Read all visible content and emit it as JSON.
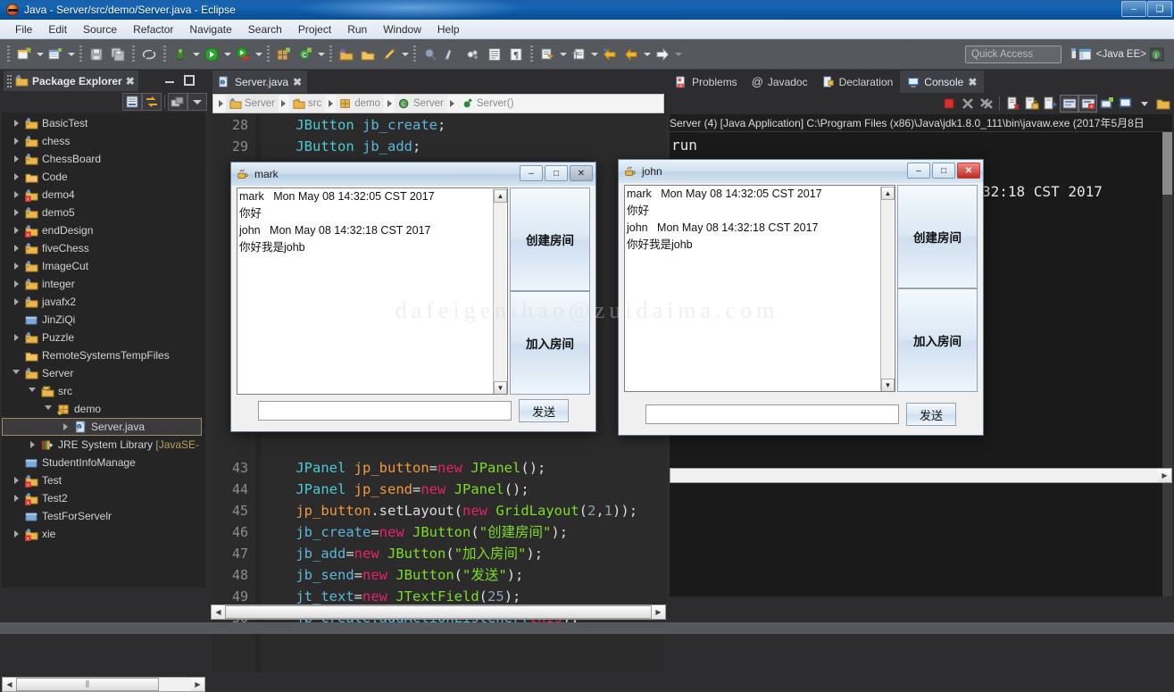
{
  "window": {
    "title": "Java - Server/src/demo/Server.java - Eclipse",
    "logo_icon": "eclipse-logo-icon",
    "minimize": "–",
    "maximize": "❑",
    "close": "✕"
  },
  "menubar": {
    "items": [
      "File",
      "Edit",
      "Source",
      "Refactor",
      "Navigate",
      "Search",
      "Project",
      "Run",
      "Window",
      "Help"
    ]
  },
  "toolbar": {
    "groups": [
      {
        "buttons": [
          {
            "icon": "new-file-icon",
            "dropdown": true
          },
          {
            "icon": "new-wizard-icon",
            "dropdown": true
          }
        ]
      },
      {
        "buttons": [
          {
            "icon": "save-icon",
            "dropdown": false
          },
          {
            "icon": "save-all-icon",
            "dropdown": false
          }
        ]
      },
      {
        "buttons": [
          {
            "icon": "no-link-icon",
            "dropdown": false
          }
        ]
      },
      {
        "buttons": [
          {
            "icon": "debug-bug-icon",
            "dropdown": true
          },
          {
            "icon": "run-green-icon",
            "dropdown": true
          },
          {
            "icon": "run-external-tools-icon",
            "dropdown": true
          }
        ]
      },
      {
        "buttons": [
          {
            "icon": "new-java-project-icon",
            "dropdown": false
          },
          {
            "icon": "new-class-icon",
            "dropdown": true
          }
        ]
      },
      {
        "buttons": [
          {
            "icon": "open-type-icon",
            "dropdown": false
          },
          {
            "icon": "open-resource-icon",
            "dropdown": false
          },
          {
            "icon": "marker-pen-icon",
            "dropdown": true
          }
        ]
      },
      {
        "buttons": [
          {
            "icon": "search-globe-icon",
            "dropdown": false
          },
          {
            "icon": "ruler-icon",
            "dropdown": false
          },
          {
            "icon": "toggle-mark-occurrences-icon",
            "dropdown": false
          },
          {
            "icon": "show-whitespace-icon",
            "dropdown": false
          },
          {
            "icon": "pilcrow-icon",
            "dropdown": false
          }
        ]
      },
      {
        "buttons": [
          {
            "icon": "next-annotation-icon",
            "dropdown": true
          },
          {
            "icon": "previous-annotation-icon",
            "dropdown": true
          }
        ]
      },
      {
        "buttons": [
          {
            "icon": "back-history-icon",
            "dropdown": false
          },
          {
            "icon": "forward-back-icon",
            "dropdown": true
          },
          {
            "icon": "forward-history-icon",
            "dropdown": true
          }
        ]
      }
    ],
    "quick_access_placeholder": "Quick Access",
    "new_perspective_icon": "new-perspective-icon",
    "perspective_icon": "java-ee-perspective-icon",
    "perspective_label": "<Java EE>"
  },
  "package_explorer": {
    "tab_title": "Package Explorer",
    "close_icon": "close-icon",
    "minimize_icon": "minimize-icon",
    "maximize_icon": "maximize-icon",
    "view_buttons": [
      {
        "icon": "collapse-all-icon",
        "framed": true
      },
      {
        "icon": "link-with-editor-icon",
        "framed": true
      },
      {
        "icon": "focus-on-active-task-icon",
        "framed": true
      },
      {
        "icon": "view-menu-icon",
        "framed": true
      }
    ],
    "tree": [
      {
        "label": "BasicTest",
        "indent": 0,
        "arrow": "closed",
        "icon": "java-project-icon",
        "selected": false
      },
      {
        "label": "chess",
        "indent": 0,
        "arrow": "closed",
        "icon": "java-project-icon",
        "selected": false
      },
      {
        "label": "ChessBoard",
        "indent": 0,
        "arrow": "closed",
        "icon": "java-project-icon",
        "selected": false
      },
      {
        "label": "Code",
        "indent": 0,
        "arrow": "closed",
        "icon": "project-folder-icon",
        "selected": false
      },
      {
        "label": "demo4",
        "indent": 0,
        "arrow": "closed",
        "icon": "java-project-error-icon",
        "selected": false
      },
      {
        "label": "demo5",
        "indent": 0,
        "arrow": "closed",
        "icon": "java-project-icon",
        "selected": false
      },
      {
        "label": "endDesign",
        "indent": 0,
        "arrow": "closed",
        "icon": "java-project-error-icon",
        "selected": false
      },
      {
        "label": "fiveChess",
        "indent": 0,
        "arrow": "closed",
        "icon": "java-project-icon",
        "selected": false
      },
      {
        "label": "ImageCut",
        "indent": 0,
        "arrow": "closed",
        "icon": "java-project-icon",
        "selected": false
      },
      {
        "label": "integer",
        "indent": 0,
        "arrow": "closed",
        "icon": "java-project-icon",
        "selected": false
      },
      {
        "label": "javafx2",
        "indent": 0,
        "arrow": "closed",
        "icon": "java-project-icon",
        "selected": false
      },
      {
        "label": "JinZiQi",
        "indent": 0,
        "arrow": "none",
        "icon": "closed-project-icon",
        "selected": false
      },
      {
        "label": "Puzzle",
        "indent": 0,
        "arrow": "closed",
        "icon": "java-project-icon",
        "selected": false
      },
      {
        "label": "RemoteSystemsTempFiles",
        "indent": 0,
        "arrow": "none",
        "icon": "project-folder-icon",
        "selected": false
      },
      {
        "label": "Server",
        "indent": 0,
        "arrow": "open",
        "icon": "java-project-icon",
        "selected": false
      },
      {
        "label": "src",
        "indent": 1,
        "arrow": "open",
        "icon": "source-folder-icon",
        "selected": false
      },
      {
        "label": "demo",
        "indent": 2,
        "arrow": "open",
        "icon": "package-icon",
        "selected": false
      },
      {
        "label": "Server.java",
        "indent": 3,
        "arrow": "closed",
        "icon": "java-file-icon",
        "selected": true
      },
      {
        "label": "JRE System Library",
        "sub": " [JavaSE-",
        "indent": 1,
        "arrow": "closed",
        "icon": "library-icon",
        "selected": false
      },
      {
        "label": "StudentInfoManage",
        "indent": 0,
        "arrow": "none",
        "icon": "closed-project-icon",
        "selected": false
      },
      {
        "label": "Test",
        "indent": 0,
        "arrow": "closed",
        "icon": "java-project-error-icon",
        "selected": false
      },
      {
        "label": "Test2",
        "indent": 0,
        "arrow": "closed",
        "icon": "java-project-error-icon",
        "selected": false
      },
      {
        "label": "TestForServelr",
        "indent": 0,
        "arrow": "none",
        "icon": "closed-project-icon",
        "selected": false
      },
      {
        "label": "xie",
        "indent": 0,
        "arrow": "closed",
        "icon": "java-project-error-icon",
        "selected": false
      }
    ],
    "hscroll": {
      "left_arrow": "◀",
      "right_arrow": "▶",
      "thumb_grip": "⫼"
    }
  },
  "editor": {
    "tab": {
      "label": "Server.java",
      "icon": "java-file-icon",
      "close_icon": "close-icon"
    },
    "breadcrumb": [
      {
        "label": "Server",
        "icon": "java-project-icon"
      },
      {
        "label": "src",
        "icon": "source-folder-icon"
      },
      {
        "label": "demo",
        "icon": "package-icon"
      },
      {
        "label": "Server",
        "icon": "java-class-icon"
      },
      {
        "label": "Server()",
        "icon": "constructor-icon"
      }
    ],
    "lines": [
      {
        "num": "28",
        "tokens": [
          {
            "t": "    ",
            "c": "k-plain"
          },
          {
            "t": "JButton",
            "c": "k-type"
          },
          {
            "t": " ",
            "c": "k-plain"
          },
          {
            "t": "jb_create",
            "c": "k-fn"
          },
          {
            "t": ";",
            "c": "k-plain"
          }
        ]
      },
      {
        "num": "29",
        "tokens": [
          {
            "t": "    ",
            "c": "k-plain"
          },
          {
            "t": "JButton",
            "c": "k-type"
          },
          {
            "t": " ",
            "c": "k-plain"
          },
          {
            "t": "jb_add",
            "c": "k-fn"
          },
          {
            "t": ";",
            "c": "k-plain"
          }
        ]
      },
      {
        "num": "43",
        "tokens": [
          {
            "t": "    ",
            "c": "k-plain"
          },
          {
            "t": "JPanel",
            "c": "k-type"
          },
          {
            "t": " ",
            "c": "k-plain"
          },
          {
            "t": "jp_button",
            "c": "k-var"
          },
          {
            "t": "=",
            "c": "k-plain"
          },
          {
            "t": "new",
            "c": "k-kw"
          },
          {
            "t": " ",
            "c": "k-plain"
          },
          {
            "t": "JPanel",
            "c": "k-cls"
          },
          {
            "t": "();",
            "c": "k-plain"
          }
        ]
      },
      {
        "num": "44",
        "tokens": [
          {
            "t": "    ",
            "c": "k-plain"
          },
          {
            "t": "JPanel",
            "c": "k-type"
          },
          {
            "t": " ",
            "c": "k-plain"
          },
          {
            "t": "jp_send",
            "c": "k-var"
          },
          {
            "t": "=",
            "c": "k-plain"
          },
          {
            "t": "new",
            "c": "k-kw"
          },
          {
            "t": " ",
            "c": "k-plain"
          },
          {
            "t": "JPanel",
            "c": "k-cls"
          },
          {
            "t": "();",
            "c": "k-plain"
          }
        ]
      },
      {
        "num": "45",
        "tokens": [
          {
            "t": "    ",
            "c": "k-plain"
          },
          {
            "t": "jp_button",
            "c": "k-var"
          },
          {
            "t": ".setLayout(",
            "c": "k-plain"
          },
          {
            "t": "new",
            "c": "k-kw"
          },
          {
            "t": " ",
            "c": "k-plain"
          },
          {
            "t": "GridLayout",
            "c": "k-cls"
          },
          {
            "t": "(",
            "c": "k-plain"
          },
          {
            "t": "2",
            "c": "k-num"
          },
          {
            "t": ",",
            "c": "k-plain"
          },
          {
            "t": "1",
            "c": "k-num"
          },
          {
            "t": "));",
            "c": "k-plain"
          }
        ]
      },
      {
        "num": "46",
        "tokens": [
          {
            "t": "    ",
            "c": "k-plain"
          },
          {
            "t": "jb_create",
            "c": "k-fn"
          },
          {
            "t": "=",
            "c": "k-plain"
          },
          {
            "t": "new",
            "c": "k-kw"
          },
          {
            "t": " ",
            "c": "k-plain"
          },
          {
            "t": "JButton",
            "c": "k-cls"
          },
          {
            "t": "(",
            "c": "k-plain"
          },
          {
            "t": "\"创建房间\"",
            "c": "k-str"
          },
          {
            "t": ");",
            "c": "k-plain"
          }
        ]
      },
      {
        "num": "47",
        "tokens": [
          {
            "t": "    ",
            "c": "k-plain"
          },
          {
            "t": "jb_add",
            "c": "k-fn"
          },
          {
            "t": "=",
            "c": "k-plain"
          },
          {
            "t": "new",
            "c": "k-kw"
          },
          {
            "t": " ",
            "c": "k-plain"
          },
          {
            "t": "JButton",
            "c": "k-cls"
          },
          {
            "t": "(",
            "c": "k-plain"
          },
          {
            "t": "\"加入房间\"",
            "c": "k-str"
          },
          {
            "t": ");",
            "c": "k-plain"
          }
        ]
      },
      {
        "num": "48",
        "tokens": [
          {
            "t": "    ",
            "c": "k-plain"
          },
          {
            "t": "jb_send",
            "c": "k-fn"
          },
          {
            "t": "=",
            "c": "k-plain"
          },
          {
            "t": "new",
            "c": "k-kw"
          },
          {
            "t": " ",
            "c": "k-plain"
          },
          {
            "t": "JButton",
            "c": "k-cls"
          },
          {
            "t": "(",
            "c": "k-plain"
          },
          {
            "t": "\"发送\"",
            "c": "k-str"
          },
          {
            "t": ");",
            "c": "k-plain"
          }
        ]
      },
      {
        "num": "49",
        "tokens": [
          {
            "t": "    ",
            "c": "k-plain"
          },
          {
            "t": "jt_text",
            "c": "k-fn"
          },
          {
            "t": "=",
            "c": "k-plain"
          },
          {
            "t": "new",
            "c": "k-kw"
          },
          {
            "t": " ",
            "c": "k-plain"
          },
          {
            "t": "JTextField",
            "c": "k-cls"
          },
          {
            "t": "(",
            "c": "k-plain"
          },
          {
            "t": "25",
            "c": "k-num"
          },
          {
            "t": ");",
            "c": "k-plain"
          }
        ]
      },
      {
        "num": "50",
        "tokens": [
          {
            "t": "    ",
            "c": "k-plain"
          },
          {
            "t": "jb create",
            "c": "k-fn"
          },
          {
            "t": ".addActionListener(",
            "c": "k-fn"
          },
          {
            "t": "this",
            "c": "k-this"
          },
          {
            "t": ");",
            "c": "k-plain"
          }
        ]
      }
    ]
  },
  "console_panel": {
    "tabs": [
      {
        "label": "Problems",
        "icon": "problems-icon",
        "active": false
      },
      {
        "label": "Javadoc",
        "icon": "javadoc-at-icon",
        "active": false
      },
      {
        "label": "Declaration",
        "icon": "declaration-icon",
        "active": false
      },
      {
        "label": "Console",
        "icon": "console-icon",
        "active": true
      }
    ],
    "close_icon": "close-icon",
    "toolbar_buttons": [
      {
        "icon": "terminate-red-square-icon",
        "framed": false
      },
      {
        "icon": "remove-launch-icon",
        "framed": false
      },
      {
        "icon": "remove-all-launches-icon",
        "framed": false
      },
      {
        "icon": "clear-console-icon",
        "framed": false
      },
      {
        "icon": "lock-scroll-icon",
        "framed": false
      },
      {
        "icon": "show-console-on-output-icon",
        "framed": false
      },
      {
        "icon": "pin-console-icon",
        "framed": true
      },
      {
        "icon": "display-selected-console-icon",
        "framed": true
      },
      {
        "icon": "open-console-icon",
        "framed": false
      },
      {
        "icon": "new-console-view-icon",
        "framed": false
      },
      {
        "icon": "console-menu-icon",
        "framed": false
      }
    ],
    "header": "Server (4) [Java Application] C:\\Program Files (x86)\\Java\\jdk1.8.0_111\\bin\\javaw.exe (2017年5月8日",
    "output_lines": [
      "run",
      "32:18 CST 2017"
    ]
  },
  "dialog_mark": {
    "title": "mark",
    "icon": "java-coffee-cup-icon",
    "minimize": "–",
    "maximize": "□",
    "close": "✕",
    "messages": [
      "mark   Mon May 08 14:32:05 CST 2017",
      "你好",
      "john   Mon May 08 14:32:18 CST 2017",
      "你好我是johb"
    ],
    "buttons": [
      "创建房间",
      "加入房间"
    ],
    "input_value": "",
    "send_label": "发送",
    "scroll_up": "▲",
    "scroll_down": "▼"
  },
  "dialog_john": {
    "title": "john",
    "icon": "java-coffee-cup-icon",
    "minimize": "–",
    "maximize": "□",
    "close": "✕",
    "messages": [
      "mark   Mon May 08 14:32:05 CST 2017",
      "你好",
      "john   Mon May 08 14:32:18 CST 2017",
      "你好我是johb"
    ],
    "buttons": [
      "创建房间",
      "加入房间"
    ],
    "input_value": "",
    "send_label": "发送",
    "scroll_up": "▲",
    "scroll_down": "▼"
  },
  "watermark": "dafeigenihao@zuidaima.com",
  "colors": {
    "titlebar_blue": "#1565b5",
    "toolbar_gray": "#55585c",
    "editor_bg": "#2b2b2b",
    "tree_bg": "#252526",
    "console_bg": "#1a1a1a",
    "selection_border": "#9a8b63",
    "accent_string_green": "#7ddc28",
    "accent_keyword_pink": "#e8216a",
    "accent_type_cyan": "#4ec9d9",
    "accent_var_orange": "#ef9a3c"
  }
}
